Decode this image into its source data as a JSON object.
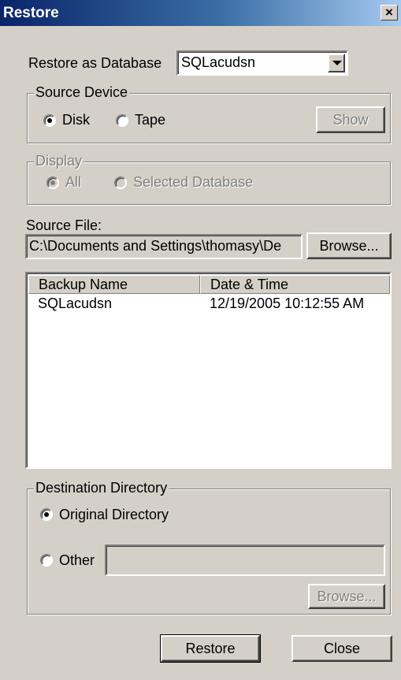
{
  "window": {
    "title": "Restore",
    "close_glyph": "×"
  },
  "restore_as": {
    "label": "Restore as Database",
    "value": "SQLacudsn"
  },
  "source_device": {
    "title": "Source Device",
    "options": [
      {
        "label": "Disk",
        "selected": true
      },
      {
        "label": "Tape",
        "selected": false
      }
    ],
    "show_button": "Show"
  },
  "display": {
    "title": "Display",
    "options": [
      {
        "label": "All",
        "selected": true
      },
      {
        "label": "Selected Database",
        "selected": false
      }
    ]
  },
  "source_file": {
    "label": "Source File:",
    "value": "C:\\Documents and Settings\\thomasy\\De",
    "browse_button": "Browse..."
  },
  "backup_list": {
    "columns": [
      "Backup Name",
      "Date & Time"
    ],
    "rows": [
      {
        "name": "SQLacudsn",
        "datetime": "12/19/2005 10:12:55 AM"
      }
    ]
  },
  "destination": {
    "title": "Destination Directory",
    "options": [
      {
        "label": "Original Directory",
        "selected": true
      },
      {
        "label": "Other",
        "selected": false
      }
    ],
    "other_value": "",
    "browse_button": "Browse..."
  },
  "buttons": {
    "restore": "Restore",
    "close": "Close"
  }
}
